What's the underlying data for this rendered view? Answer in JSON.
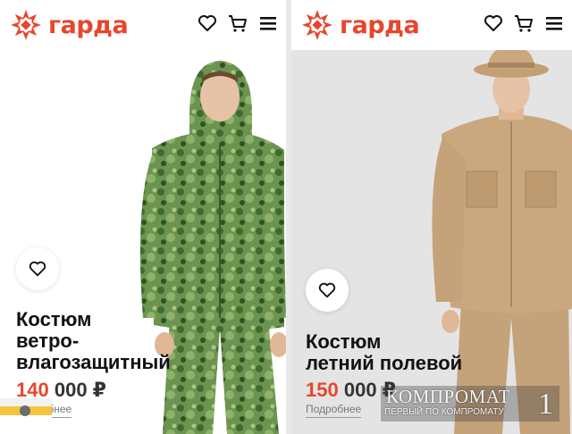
{
  "brand": {
    "name": "гарда",
    "color": "#e8452c"
  },
  "header_icons": [
    "heart-icon",
    "cart-icon",
    "menu-icon"
  ],
  "products": [
    {
      "title_lines": [
        "Костюм",
        "ветро-",
        "влагозащитный"
      ],
      "price_main": "140",
      "price_rest": "000 ₽",
      "more_label": "Подробнее",
      "photo_background": "#ffffff",
      "garment_color": "#5f8a45"
    },
    {
      "title_lines": [
        "Костюм",
        "летний полевой"
      ],
      "price_main": "150",
      "price_rest": "000 ₽",
      "more_label": "Подробнее",
      "photo_background": "#e4e4e4",
      "garment_color": "#c6a47c"
    }
  ],
  "watermark": {
    "main": "КОМПРОМАТ",
    "sub": "ПЕРВЫЙ ПО КОМПРОМАТУ",
    "number": "1"
  }
}
